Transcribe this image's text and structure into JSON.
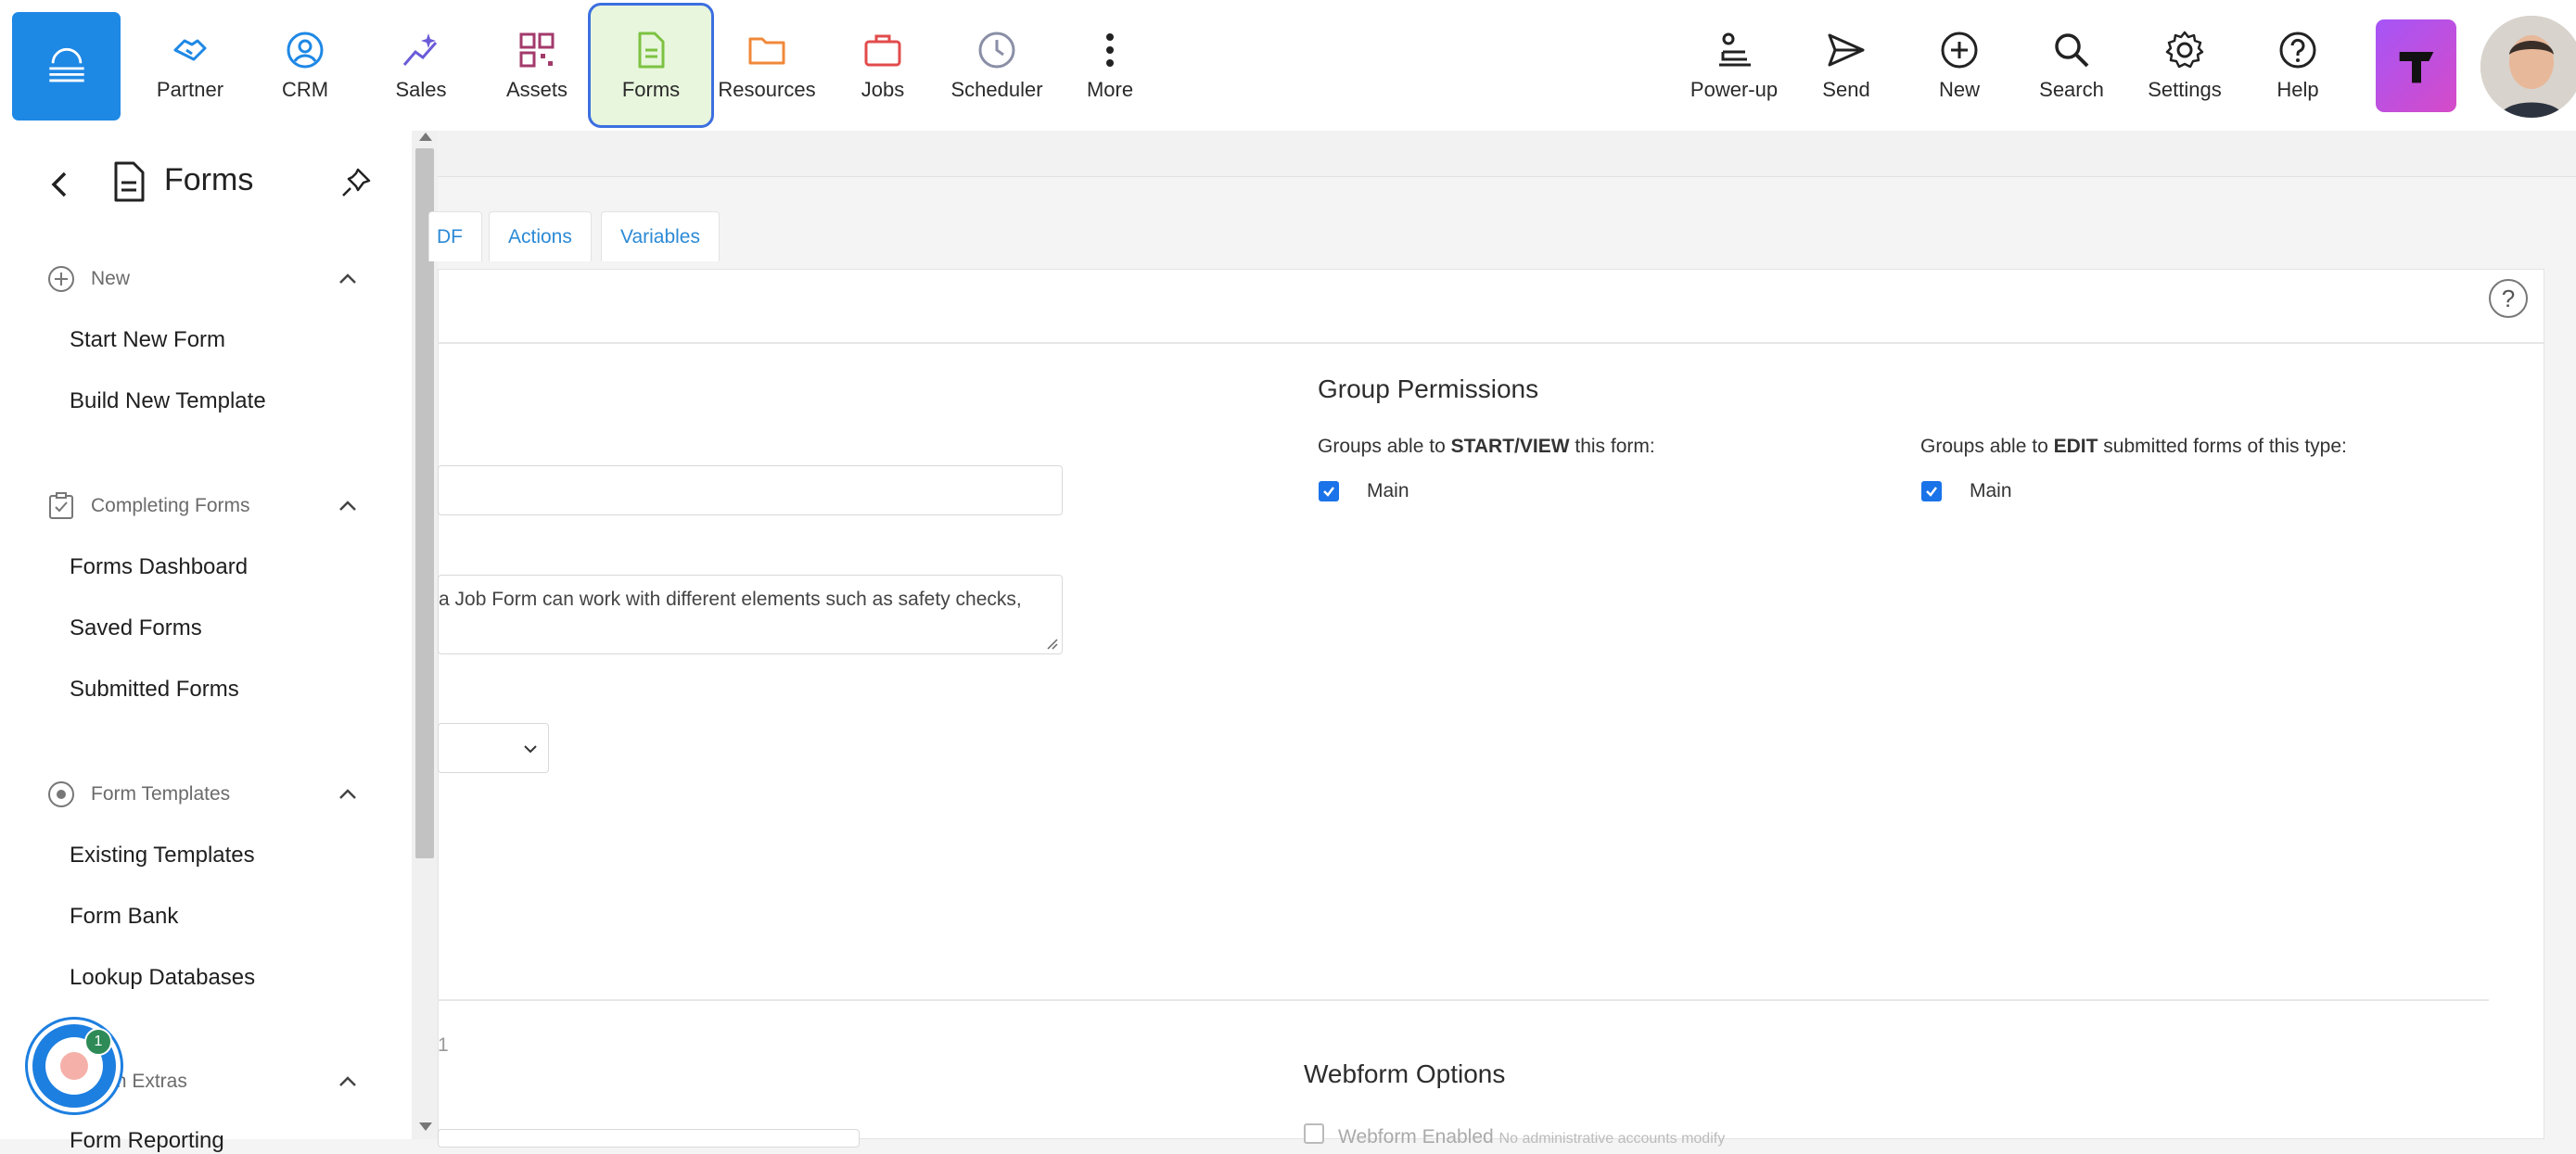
{
  "nav": {
    "items": [
      {
        "label": "Partner",
        "icon": "handshake-icon",
        "color": "#1e88e5"
      },
      {
        "label": "CRM",
        "icon": "user-circle-icon",
        "color": "#1e88e5"
      },
      {
        "label": "Sales",
        "icon": "sparkle-chart-icon",
        "color": "#6a5bd9"
      },
      {
        "label": "Assets",
        "icon": "qr-grid-icon",
        "color": "#a33a6b"
      },
      {
        "label": "Forms",
        "icon": "document-icon",
        "color": "#7cc242"
      },
      {
        "label": "Resources",
        "icon": "folder-icon",
        "color": "#f0883a"
      },
      {
        "label": "Jobs",
        "icon": "briefcase-icon",
        "color": "#e24b4b"
      },
      {
        "label": "Scheduler",
        "icon": "clock-icon",
        "color": "#8a8fa6"
      },
      {
        "label": "More",
        "icon": "more-vertical-icon",
        "color": "#222222"
      }
    ],
    "right_items": [
      {
        "label": "Power-up",
        "icon": "power-up-icon"
      },
      {
        "label": "Send",
        "icon": "send-icon"
      },
      {
        "label": "New",
        "icon": "plus-circle-icon"
      },
      {
        "label": "Search",
        "icon": "search-icon"
      },
      {
        "label": "Settings",
        "icon": "gear-icon"
      },
      {
        "label": "Help",
        "icon": "help-circle-icon"
      }
    ],
    "active": "Forms",
    "active_bg": "#e8f6dd",
    "active_border": "#3c6fe0"
  },
  "sidebar": {
    "title": "Forms",
    "sections": [
      {
        "label": "New",
        "icon": "plus-circle-icon",
        "links": [
          "Start New Form",
          "Build New Template"
        ]
      },
      {
        "label": "Completing Forms",
        "icon": "checklist-icon",
        "links": [
          "Forms Dashboard",
          "Saved Forms",
          "Submitted Forms"
        ]
      },
      {
        "label": "Form Templates",
        "icon": "target-icon",
        "links": [
          "Existing Templates",
          "Form Bank",
          "Lookup Databases"
        ]
      },
      {
        "label": "rm Extras",
        "icon": "extras-icon",
        "links": [
          "Form Reporting"
        ]
      }
    ]
  },
  "chat": {
    "badge": "1"
  },
  "main": {
    "tabs": [
      "DF",
      "Actions",
      "Variables"
    ],
    "help": "?",
    "textarea_text": "a Job Form can work with different elements such as safety checks,",
    "group_permissions": {
      "title": "Group Permissions",
      "start_view_prefix": "Groups able to ",
      "start_view_bold": "START/VIEW",
      "start_view_suffix": " this form:",
      "edit_prefix": "Groups able to ",
      "edit_bold": "EDIT",
      "edit_suffix": " submitted forms of this type:",
      "start_view_group": "Main",
      "edit_group": "Main"
    },
    "partial_number": "1",
    "webform": {
      "title": "Webform Options",
      "enabled_label": "Webform Enabled",
      "enabled_note": "No administrative accounts modify"
    }
  }
}
